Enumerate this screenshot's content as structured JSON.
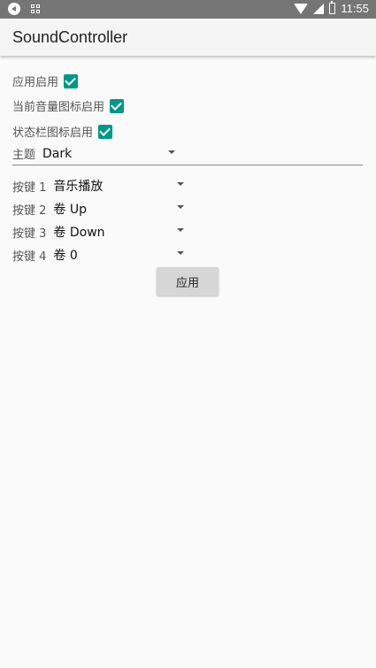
{
  "status_bar": {
    "time": "11:55",
    "icons": [
      "media-icon",
      "qr-icon",
      "wifi-icon",
      "signal-icon",
      "battery-icon"
    ]
  },
  "app": {
    "title": "SoundController"
  },
  "settings": {
    "app_enabled": {
      "label": "应用启用",
      "checked": true
    },
    "volume_icon_enabled": {
      "label": "当前音量图标启用",
      "checked": true
    },
    "statusbar_icon_enabled": {
      "label": "状态栏图标启用",
      "checked": true
    },
    "theme": {
      "label": "主题",
      "value": "Dark"
    }
  },
  "keys": [
    {
      "label": "按键 1",
      "value": "音乐播放"
    },
    {
      "label": "按键 2",
      "value": "卷 Up"
    },
    {
      "label": "按键 3",
      "value": "卷 Down"
    },
    {
      "label": "按键 4",
      "value": "卷 0"
    }
  ],
  "apply_button": {
    "label": "应用"
  },
  "colors": {
    "accent": "#009688",
    "status_bar": "#757575",
    "app_bar": "#f5f5f5",
    "background": "#fafafa"
  }
}
